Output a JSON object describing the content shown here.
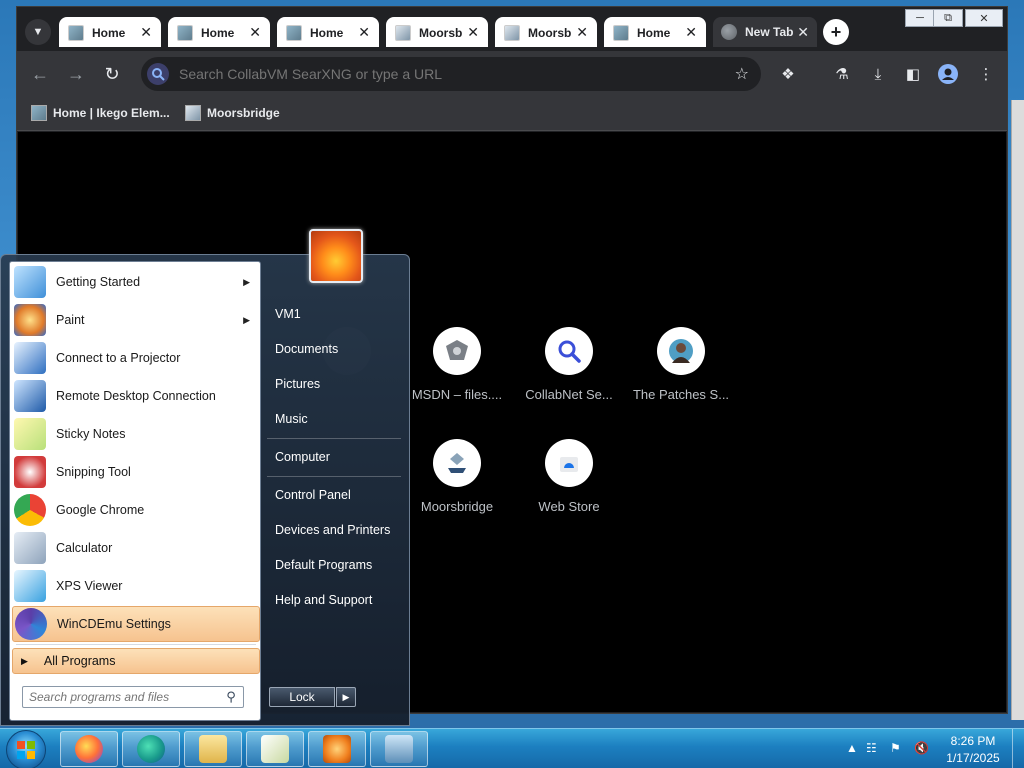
{
  "browser": {
    "tabs": [
      {
        "title": "Home",
        "favicon": "school-favicon",
        "active": false
      },
      {
        "title": "Home",
        "favicon": "school-favicon",
        "active": false
      },
      {
        "title": "Home",
        "favicon": "school-favicon",
        "active": false
      },
      {
        "title": "Moorsbridge",
        "favicon": "moorsbridge-favicon",
        "active": false
      },
      {
        "title": "Moorsbridge",
        "favicon": "moorsbridge-favicon",
        "active": false
      },
      {
        "title": "Home",
        "favicon": "school-favicon",
        "active": false
      },
      {
        "title": "New Tab",
        "favicon": "globe-icon",
        "active": true
      }
    ],
    "omnibox_placeholder": "Search CollabVM SearXNG or type a URL",
    "bookmarks": [
      {
        "label": "Home | Ikego Elem..."
      },
      {
        "label": "Moorsbridge"
      }
    ],
    "shortcuts": [
      {
        "label": "",
        "icon": "blank-icon"
      },
      {
        "label": "MSDN – files....",
        "icon": "msdn-icon"
      },
      {
        "label": "CollabNet Se...",
        "icon": "search-icon"
      },
      {
        "label": "The Patches S...",
        "icon": "portrait-icon"
      },
      {
        "label": "Moorsbridge",
        "icon": "moorsbridge-icon"
      },
      {
        "label": "Web Store",
        "icon": "web-store-icon"
      }
    ],
    "colors": {
      "frame": "#202124",
      "toolbar": "#35363a",
      "content": "#000000"
    }
  },
  "start_menu": {
    "programs": [
      {
        "label": "Getting Started",
        "submenu": true
      },
      {
        "label": "Paint",
        "submenu": true
      },
      {
        "label": "Connect to a Projector",
        "submenu": false
      },
      {
        "label": "Remote Desktop Connection",
        "submenu": false
      },
      {
        "label": "Sticky Notes",
        "submenu": false
      },
      {
        "label": "Snipping Tool",
        "submenu": false
      },
      {
        "label": "Google Chrome",
        "submenu": false
      },
      {
        "label": "Calculator",
        "submenu": false
      },
      {
        "label": "XPS Viewer",
        "submenu": false
      },
      {
        "label": "WinCDEmu Settings",
        "submenu": false,
        "highlighted": true
      }
    ],
    "all_programs": "All Programs",
    "search_placeholder": "Search programs and files",
    "right_items": [
      {
        "label": "VM1"
      },
      {
        "label": "Documents"
      },
      {
        "label": "Pictures"
      },
      {
        "label": "Music"
      },
      {
        "label": "Computer"
      },
      {
        "label": "Control Panel"
      },
      {
        "label": "Devices and Printers"
      },
      {
        "label": "Default Programs"
      },
      {
        "label": "Help and Support"
      }
    ],
    "lock_label": "Lock"
  },
  "taskbar": {
    "pinned": [
      "firefox-icon",
      "edge-icon",
      "explorer-icon",
      "notepad-icon",
      "media-player-icon",
      "window-icon"
    ],
    "clock": {
      "time": "8:26 PM",
      "date": "1/17/2025"
    }
  }
}
